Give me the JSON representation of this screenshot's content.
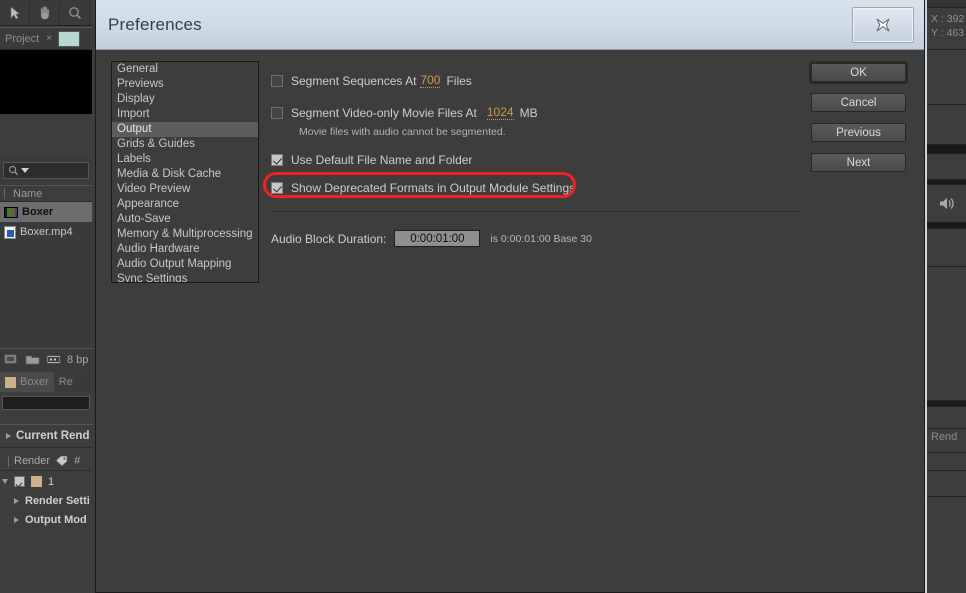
{
  "app": {
    "toolbar": {
      "tools": [
        "selection-tool",
        "hand-tool",
        "zoom-tool"
      ]
    },
    "project_panel": {
      "tab_label": "Project",
      "close_glyph": "×",
      "search_placeholder": "",
      "column_header": "Name",
      "items": [
        {
          "label": "Boxer",
          "type": "composition",
          "selected": true
        },
        {
          "label": "Boxer.mp4",
          "type": "file",
          "selected": false
        }
      ],
      "bit_depth": "8 bp"
    },
    "render_queue": {
      "tab_label": "Boxer",
      "tab_label_2": "Re",
      "current_render_label": "Current Rend",
      "column_render": "Render",
      "column_comment": "#",
      "row_index": "1",
      "sub_items": [
        "Render Setti",
        "Output Mod"
      ]
    },
    "right_panel": {
      "coord_x": "X : 392",
      "coord_y": "Y : 463",
      "audio_icon": "speaker-icon",
      "render_label": "Rend"
    }
  },
  "dialog": {
    "title": "Preferences",
    "close_label": "✕",
    "categories": [
      {
        "label": "General",
        "selected": false
      },
      {
        "label": "Previews",
        "selected": false
      },
      {
        "label": "Display",
        "selected": false
      },
      {
        "label": "Import",
        "selected": false
      },
      {
        "label": "Output",
        "selected": true
      },
      {
        "label": "Grids & Guides",
        "selected": false
      },
      {
        "label": "Labels",
        "selected": false
      },
      {
        "label": "Media & Disk Cache",
        "selected": false
      },
      {
        "label": "Video Preview",
        "selected": false
      },
      {
        "label": "Appearance",
        "selected": false
      },
      {
        "label": "Auto-Save",
        "selected": false
      },
      {
        "label": "Memory & Multiprocessing",
        "selected": false
      },
      {
        "label": "Audio Hardware",
        "selected": false
      },
      {
        "label": "Audio Output Mapping",
        "selected": false
      },
      {
        "label": "Sync Settings",
        "selected": false
      }
    ],
    "settings": {
      "segment_sequences": {
        "label": "Segment Sequences At",
        "value": "700",
        "unit": "Files",
        "checked": false
      },
      "segment_video_only": {
        "label": "Segment Video-only Movie Files At",
        "value": "1024",
        "unit": "MB",
        "checked": false
      },
      "segment_hint": "Movie files with audio cannot be segmented.",
      "use_default_name": {
        "label": "Use Default File Name and Folder",
        "checked": true
      },
      "show_deprecated": {
        "label": "Show Deprecated Formats in Output Module Settings",
        "checked": true,
        "highlighted": true
      },
      "audio_block_duration": {
        "label": "Audio Block Duration:",
        "value": "0:00:01:00",
        "note": "is 0:00:01:00  Base 30"
      }
    },
    "buttons": [
      {
        "label": "OK",
        "default": true
      },
      {
        "label": "Cancel",
        "default": false
      },
      {
        "label": "Previous",
        "default": false
      },
      {
        "label": "Next",
        "default": false
      }
    ]
  },
  "annotation": {
    "color": "#ee2222",
    "target": "show-deprecated-formats-checkbox-row"
  }
}
